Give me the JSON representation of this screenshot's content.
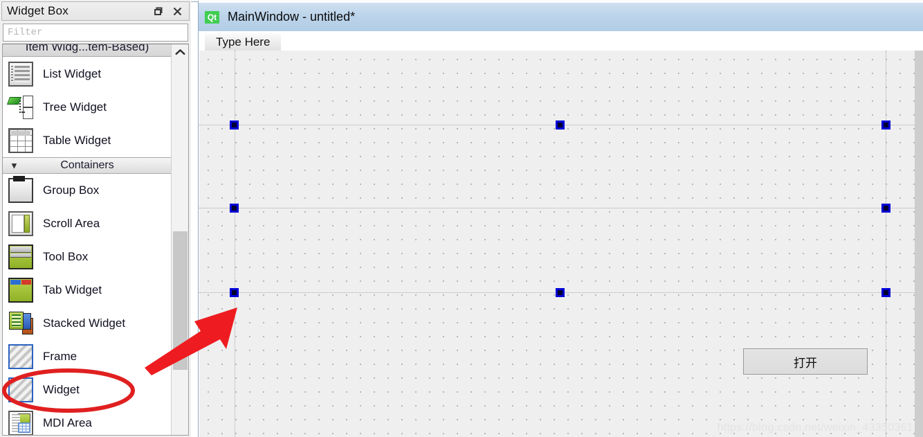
{
  "widget_box": {
    "title": "Widget Box",
    "float_icon": "restore-window-icon",
    "close_icon": "close-icon",
    "filter": {
      "value": "",
      "placeholder": "Filter"
    },
    "clipped_category": "Item Widg...tem-Based)",
    "scroll_up_icon": "chevron-up-icon",
    "groups": [
      {
        "name": "Item Widgets (Item-Based)",
        "clipped": true,
        "items": [
          {
            "label": "List Widget",
            "icon": "list-widget-icon"
          },
          {
            "label": "Tree Widget",
            "icon": "tree-widget-icon"
          },
          {
            "label": "Table Widget",
            "icon": "table-widget-icon"
          }
        ]
      },
      {
        "name": "Containers",
        "chevron": "chevron-down-icon",
        "clipped": false,
        "items": [
          {
            "label": "Group Box",
            "icon": "group-box-icon"
          },
          {
            "label": "Scroll Area",
            "icon": "scroll-area-icon"
          },
          {
            "label": "Tool Box",
            "icon": "tool-box-icon"
          },
          {
            "label": "Tab Widget",
            "icon": "tab-widget-icon"
          },
          {
            "label": "Stacked Widget",
            "icon": "stacked-widget-icon"
          },
          {
            "label": "Frame",
            "icon": "frame-icon"
          },
          {
            "label": "Widget",
            "icon": "widget-icon",
            "highlighted": true
          },
          {
            "label": "MDI Area",
            "icon": "mdi-area-icon"
          }
        ]
      }
    ]
  },
  "main_window": {
    "logo_text": "Qt",
    "title": "MainWindow - untitled*",
    "menubar": {
      "type_here": "Type Here"
    },
    "canvas": {
      "open_button": "打开",
      "watermark": "https://blog.csdn.net/weixin_43350361"
    }
  },
  "colors": {
    "qt_green": "#41cd52",
    "titlebar_blue": "#bcd4ea",
    "handle_blue": "#0000d6",
    "annotation_red": "#e02020",
    "canvas_gray": "#efefef"
  }
}
